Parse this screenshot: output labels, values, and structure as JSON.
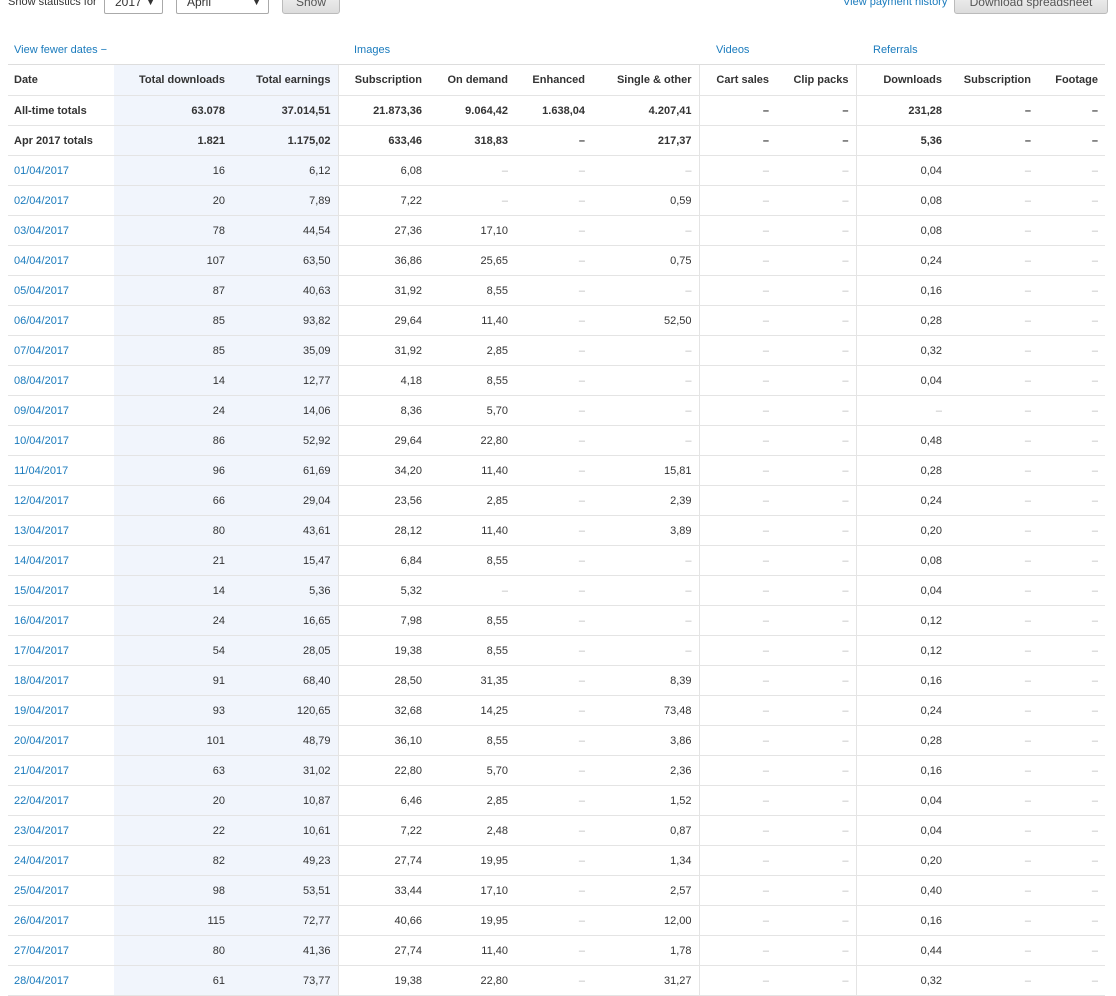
{
  "filter": {
    "label": "Show statistics for",
    "year": "2017",
    "month": "April",
    "show_label": "Show"
  },
  "header_links": {
    "payment_history": "View payment history",
    "download_spreadsheet": "Download spreadsheet"
  },
  "groups": {
    "view_fewer": "View fewer dates −",
    "images": "Images",
    "videos": "Videos",
    "referrals": "Referrals"
  },
  "columns": [
    "Date",
    "Total downloads",
    "Total earnings",
    "Subscription",
    "On demand",
    "Enhanced",
    "Single & other",
    "Cart sales",
    "Clip packs",
    "Downloads",
    "Subscription",
    "Footage"
  ],
  "totals": [
    [
      "All-time totals",
      "63.078",
      "37.014,51",
      "21.873,36",
      "9.064,42",
      "1.638,04",
      "4.207,41",
      "–",
      "–",
      "231,28",
      "–",
      "–"
    ],
    [
      "Apr 2017 totals",
      "1.821",
      "1.175,02",
      "633,46",
      "318,83",
      "–",
      "217,37",
      "–",
      "–",
      "5,36",
      "–",
      "–"
    ]
  ],
  "rows": [
    [
      "01/04/2017",
      "16",
      "6,12",
      "6,08",
      "–",
      "–",
      "–",
      "–",
      "–",
      "0,04",
      "–",
      "–"
    ],
    [
      "02/04/2017",
      "20",
      "7,89",
      "7,22",
      "–",
      "–",
      "0,59",
      "–",
      "–",
      "0,08",
      "–",
      "–"
    ],
    [
      "03/04/2017",
      "78",
      "44,54",
      "27,36",
      "17,10",
      "–",
      "–",
      "–",
      "–",
      "0,08",
      "–",
      "–"
    ],
    [
      "04/04/2017",
      "107",
      "63,50",
      "36,86",
      "25,65",
      "–",
      "0,75",
      "–",
      "–",
      "0,24",
      "–",
      "–"
    ],
    [
      "05/04/2017",
      "87",
      "40,63",
      "31,92",
      "8,55",
      "–",
      "–",
      "–",
      "–",
      "0,16",
      "–",
      "–"
    ],
    [
      "06/04/2017",
      "85",
      "93,82",
      "29,64",
      "11,40",
      "–",
      "52,50",
      "–",
      "–",
      "0,28",
      "–",
      "–"
    ],
    [
      "07/04/2017",
      "85",
      "35,09",
      "31,92",
      "2,85",
      "–",
      "–",
      "–",
      "–",
      "0,32",
      "–",
      "–"
    ],
    [
      "08/04/2017",
      "14",
      "12,77",
      "4,18",
      "8,55",
      "–",
      "–",
      "–",
      "–",
      "0,04",
      "–",
      "–"
    ],
    [
      "09/04/2017",
      "24",
      "14,06",
      "8,36",
      "5,70",
      "–",
      "–",
      "–",
      "–",
      "–",
      "–",
      "–"
    ],
    [
      "10/04/2017",
      "86",
      "52,92",
      "29,64",
      "22,80",
      "–",
      "–",
      "–",
      "–",
      "0,48",
      "–",
      "–"
    ],
    [
      "11/04/2017",
      "96",
      "61,69",
      "34,20",
      "11,40",
      "–",
      "15,81",
      "–",
      "–",
      "0,28",
      "–",
      "–"
    ],
    [
      "12/04/2017",
      "66",
      "29,04",
      "23,56",
      "2,85",
      "–",
      "2,39",
      "–",
      "–",
      "0,24",
      "–",
      "–"
    ],
    [
      "13/04/2017",
      "80",
      "43,61",
      "28,12",
      "11,40",
      "–",
      "3,89",
      "–",
      "–",
      "0,20",
      "–",
      "–"
    ],
    [
      "14/04/2017",
      "21",
      "15,47",
      "6,84",
      "8,55",
      "–",
      "–",
      "–",
      "–",
      "0,08",
      "–",
      "–"
    ],
    [
      "15/04/2017",
      "14",
      "5,36",
      "5,32",
      "–",
      "–",
      "–",
      "–",
      "–",
      "0,04",
      "–",
      "–"
    ],
    [
      "16/04/2017",
      "24",
      "16,65",
      "7,98",
      "8,55",
      "–",
      "–",
      "–",
      "–",
      "0,12",
      "–",
      "–"
    ],
    [
      "17/04/2017",
      "54",
      "28,05",
      "19,38",
      "8,55",
      "–",
      "–",
      "–",
      "–",
      "0,12",
      "–",
      "–"
    ],
    [
      "18/04/2017",
      "91",
      "68,40",
      "28,50",
      "31,35",
      "–",
      "8,39",
      "–",
      "–",
      "0,16",
      "–",
      "–"
    ],
    [
      "19/04/2017",
      "93",
      "120,65",
      "32,68",
      "14,25",
      "–",
      "73,48",
      "–",
      "–",
      "0,24",
      "–",
      "–"
    ],
    [
      "20/04/2017",
      "101",
      "48,79",
      "36,10",
      "8,55",
      "–",
      "3,86",
      "–",
      "–",
      "0,28",
      "–",
      "–"
    ],
    [
      "21/04/2017",
      "63",
      "31,02",
      "22,80",
      "5,70",
      "–",
      "2,36",
      "–",
      "–",
      "0,16",
      "–",
      "–"
    ],
    [
      "22/04/2017",
      "20",
      "10,87",
      "6,46",
      "2,85",
      "–",
      "1,52",
      "–",
      "–",
      "0,04",
      "–",
      "–"
    ],
    [
      "23/04/2017",
      "22",
      "10,61",
      "7,22",
      "2,48",
      "–",
      "0,87",
      "–",
      "–",
      "0,04",
      "–",
      "–"
    ],
    [
      "24/04/2017",
      "82",
      "49,23",
      "27,74",
      "19,95",
      "–",
      "1,34",
      "–",
      "–",
      "0,20",
      "–",
      "–"
    ],
    [
      "25/04/2017",
      "98",
      "53,51",
      "33,44",
      "17,10",
      "–",
      "2,57",
      "–",
      "–",
      "0,40",
      "–",
      "–"
    ],
    [
      "26/04/2017",
      "115",
      "72,77",
      "40,66",
      "19,95",
      "–",
      "12,00",
      "–",
      "–",
      "0,16",
      "–",
      "–"
    ],
    [
      "27/04/2017",
      "80",
      "41,36",
      "27,74",
      "11,40",
      "–",
      "1,78",
      "–",
      "–",
      "0,44",
      "–",
      "–"
    ],
    [
      "28/04/2017",
      "61",
      "73,77",
      "19,38",
      "22,80",
      "–",
      "31,27",
      "–",
      "–",
      "0,32",
      "–",
      "–"
    ]
  ]
}
